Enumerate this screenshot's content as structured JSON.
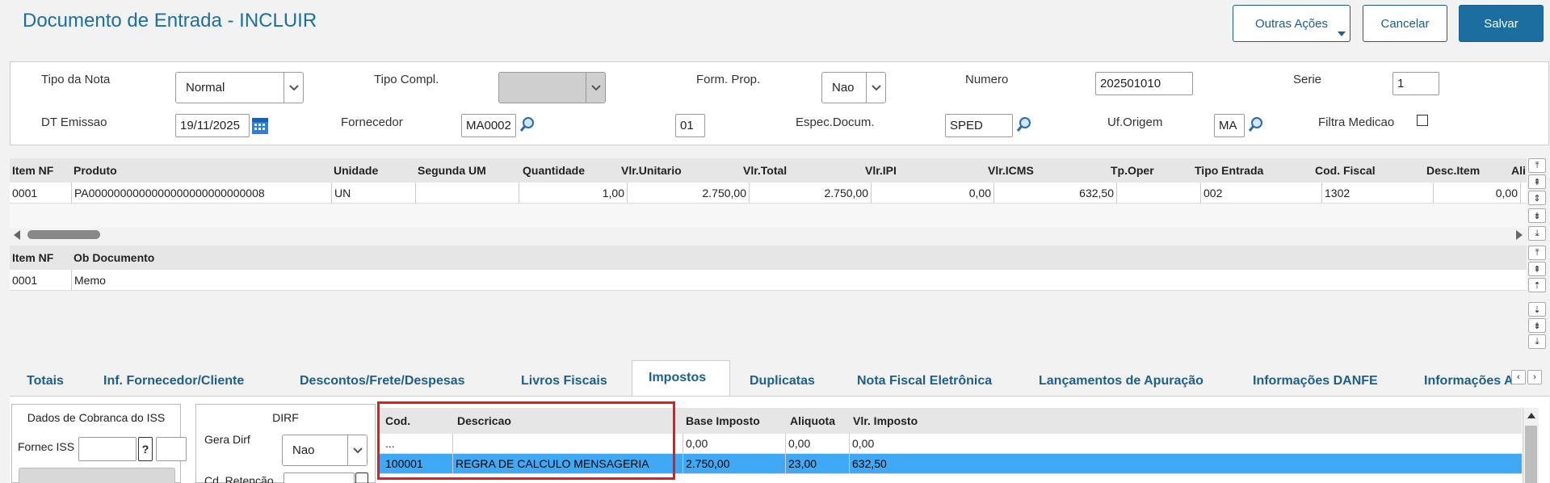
{
  "header": {
    "title": "Documento de Entrada - INCLUIR",
    "outras_acoes": "Outras Ações",
    "cancelar": "Cancelar",
    "salvar": "Salvar"
  },
  "form": {
    "tipo_nota_label": "Tipo da Nota",
    "tipo_nota_value": "Normal",
    "tipo_compl_label": "Tipo Compl.",
    "form_prop_label": "Form. Prop.",
    "form_prop_value": "Nao",
    "numero_label": "Numero",
    "numero_value": "202501010",
    "serie_label": "Serie",
    "serie_value": "1",
    "dt_emissao_label": "DT Emissao",
    "dt_emissao_value": "19/11/2025",
    "fornecedor_label": "Fornecedor",
    "fornecedor_value": "MA0002",
    "loja_value": "01",
    "espec_label": "Espec.Docum.",
    "espec_value": "SPED",
    "uf_label": "Uf.Origem",
    "uf_value": "MA",
    "filtra_label": "Filtra Medicao"
  },
  "items_grid": {
    "columns": [
      "Item NF",
      "Produto",
      "Unidade",
      "Segunda UM",
      "Quantidade",
      "Vlr.Unitario",
      "Vlr.Total",
      "Vlr.IPI",
      "Vlr.ICMS",
      "Tp.Oper",
      "Tipo Entrada",
      "Cod. Fiscal",
      "Desc.Item",
      "Ali"
    ],
    "row": [
      "0001",
      "PA0000000000000000000000000008",
      "UN",
      "",
      "1,00",
      "2.750,00",
      "2.750,00",
      "0,00",
      "632,50",
      "",
      "002",
      "1302",
      "0,00",
      ""
    ]
  },
  "obs_grid": {
    "columns": [
      "Item NF",
      "Ob Documento"
    ],
    "row": [
      "0001",
      "Memo"
    ]
  },
  "tabs": [
    "Totais",
    "Inf. Fornecedor/Cliente",
    "Descontos/Frete/Despesas",
    "Livros Fiscais",
    "Impostos",
    "Duplicatas",
    "Nota Fiscal Eletrônica",
    "Lançamentos de Apuração",
    "Informações DANFE",
    "Informações Ad"
  ],
  "iss": {
    "title": "Dados de Cobranca do ISS",
    "fornec_label": "Fornec ISS",
    "help": "?"
  },
  "dirf": {
    "title": "DIRF",
    "gera_label": "Gera Dirf",
    "gera_value": "Nao",
    "cd_ret_label": "Cd. Retenção"
  },
  "tax_grid": {
    "columns": [
      "Cod.",
      "Descricao",
      "Base Imposto",
      "Aliquota",
      "Vlr. Imposto"
    ],
    "rows": [
      [
        "...",
        "",
        "0,00",
        "0,00",
        "0,00"
      ],
      [
        "100001",
        "REGRA DE CALCULO MENSAGERIA",
        "2.750,00",
        "23,00",
        "632,50"
      ]
    ]
  }
}
